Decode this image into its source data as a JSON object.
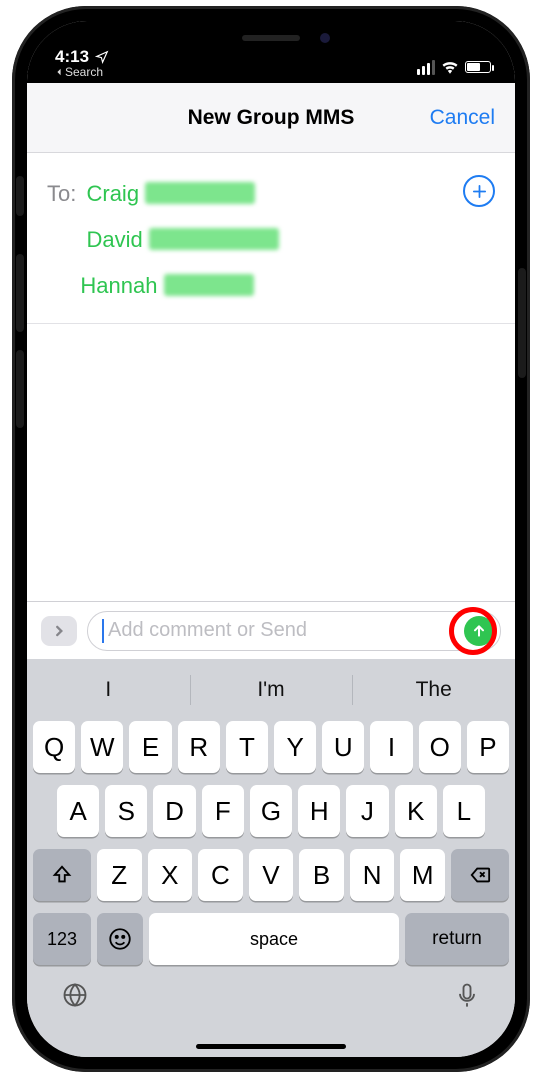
{
  "status": {
    "time": "4:13",
    "back_label": "Search"
  },
  "navbar": {
    "title": "New Group MMS",
    "cancel": "Cancel"
  },
  "recipients": {
    "to_label": "To:",
    "contacts": [
      "Craig",
      "David",
      "Hannah"
    ]
  },
  "compose": {
    "placeholder": "Add comment or Send"
  },
  "keyboard": {
    "predictions": [
      "I",
      "I'm",
      "The"
    ],
    "row1": [
      "Q",
      "W",
      "E",
      "R",
      "T",
      "Y",
      "U",
      "I",
      "O",
      "P"
    ],
    "row2": [
      "A",
      "S",
      "D",
      "F",
      "G",
      "H",
      "J",
      "K",
      "L"
    ],
    "row3": [
      "Z",
      "X",
      "C",
      "V",
      "B",
      "N",
      "M"
    ],
    "sym": "123",
    "space": "space",
    "ret": "return"
  }
}
